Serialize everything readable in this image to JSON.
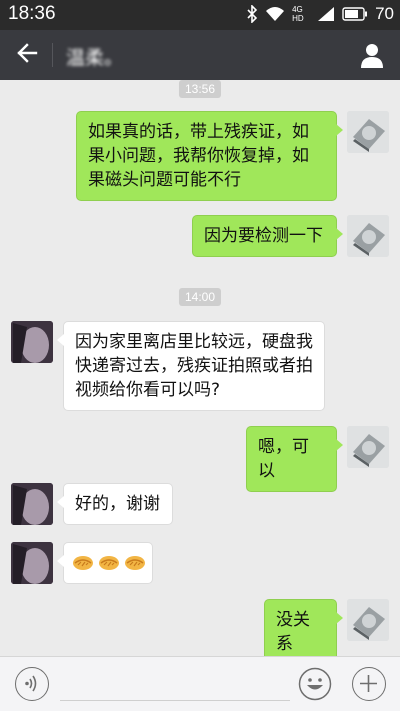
{
  "status_bar": {
    "time": "18:36",
    "network_label": "4G",
    "network_sub": "HD",
    "battery": "70",
    "icons": [
      "bluetooth-icon",
      "wifi-icon",
      "signal-icon",
      "battery-icon"
    ]
  },
  "title_bar": {
    "title": "温柔。",
    "back_icon": "back-arrow-icon",
    "profile_icon": "person-icon"
  },
  "timestamps": [
    "13:56",
    "14:00"
  ],
  "messages": [
    {
      "from": "me",
      "type": "text",
      "text": "如果真的话，带上残疾证，如果小问题，我帮你恢复掉，如果磁头问题可能不行"
    },
    {
      "from": "me",
      "type": "text",
      "text": "因为要检测一下"
    },
    {
      "from": "other",
      "type": "text",
      "text": "因为家里离店里比较远，硬盘我快递寄过去，残疾证拍照或者拍视频给你看可以吗?"
    },
    {
      "from": "me",
      "type": "text",
      "text": "嗯，可以"
    },
    {
      "from": "other",
      "type": "text",
      "text": "好的，谢谢"
    },
    {
      "from": "other",
      "type": "emoji",
      "text": "",
      "emoji": [
        "handshake-emoji",
        "handshake-emoji",
        "handshake-emoji"
      ]
    },
    {
      "from": "me",
      "type": "text",
      "text": "没关系"
    }
  ],
  "input_bar": {
    "voice_icon": "voice-icon",
    "placeholder": "",
    "emoji_icon": "smiley-icon",
    "plus_icon": "plus-icon"
  },
  "colors": {
    "status_bar_bg": "#2b2b2b",
    "title_bar_bg": "#393a3f",
    "chat_bg": "#ebebeb",
    "my_bubble": "#a0e75a",
    "their_bubble": "#ffffff",
    "timestamp_bg": "#cecece"
  }
}
